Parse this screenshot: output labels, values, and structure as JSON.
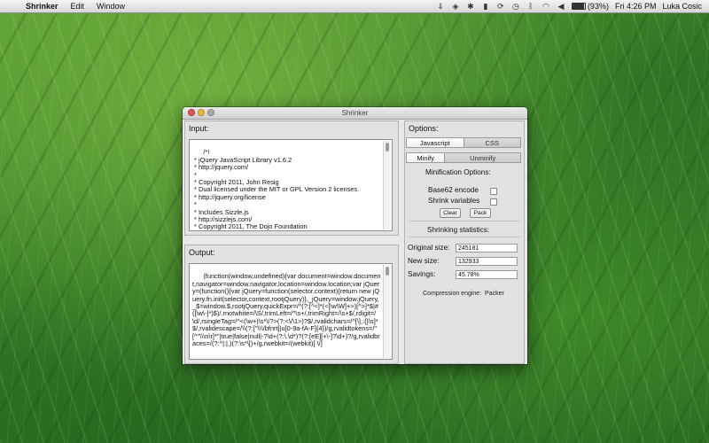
{
  "menubar": {
    "app_name": "Shrinker",
    "items": [
      "Edit",
      "Window"
    ],
    "battery": "(93%)",
    "clock": "Fri 4:26 PM",
    "user": "Luka Cosic"
  },
  "window": {
    "title": "Shrinker",
    "input": {
      "label": "Input:",
      "text": "/*!\n * jQuery JavaScript Library v1.6.2\n * http://jquery.com/\n *\n * Copyright 2011, John Resig\n * Dual licensed under the MIT or GPL Version 2 licenses.\n * http://jquery.org/license\n *\n * Includes Sizzle.js\n * http://sizzlejs.com/\n * Copyright 2011, The Dojo Foundation\n * Released under the MIT, BSD, and GPL Licenses."
    },
    "output": {
      "label": "Output:",
      "text": "(function(window,undefined){var document=window.document,navigator=window.navigator,location=window.location;var jQuery=(function(){var jQuery=function(selector,context){return new jQuery.fn.init(selector,context,rootjQuery)},_jQuery=window.jQuery,_$=window.$,rootjQuery,quickExpr=/^(?:[^<]*(<[\\w\\W]+>)[^>]*$|#([\\w\\-]*)$)/,rnotwhite=/\\S/,trimLeft=/^\\s+/,trimRight=/\\s+$/,rdigit=/\\d/,rsingleTag=/^<(\\w+)\\s*\\/?>(?:<\\/\\1>)?$/,rvalidchars=/^[\\],:{}\\s]*$/,rvalidescape=/\\\\(?:[\"\\\\\\/bfnrt]|u[0-9a-fA-F]{4})/g,rvalidtokens=/\"[^\"\\\\\\n\\r]*\"|true|false|null|-?\\d+(?:\\.\\d*)?(?:[eE][+\\-]?\\d+)?/g,rvalidbraces=/(?:^|:|,)(?:\\s*\\[)+/g,rwebkit=/(webkit)[ \\/]"
    },
    "options": {
      "label": "Options:",
      "lang_tabs": [
        "Javascript",
        "CSS"
      ],
      "mode_tabs": [
        "Minify",
        "Unminify"
      ],
      "minification_title": "Minification Options:",
      "base62": "Base62 encode",
      "shrink": "Shrink variables",
      "clear_btn": "Clear",
      "pack_btn": "Pack",
      "stats_title": "Shrinking statistics:",
      "original_size_label": "Original size:",
      "original_size": "245181",
      "new_size_label": "New size:",
      "new_size": "132933",
      "savings_label": "Savings:",
      "savings": "45.78%",
      "engine": "Compression engine:  Packer"
    }
  }
}
